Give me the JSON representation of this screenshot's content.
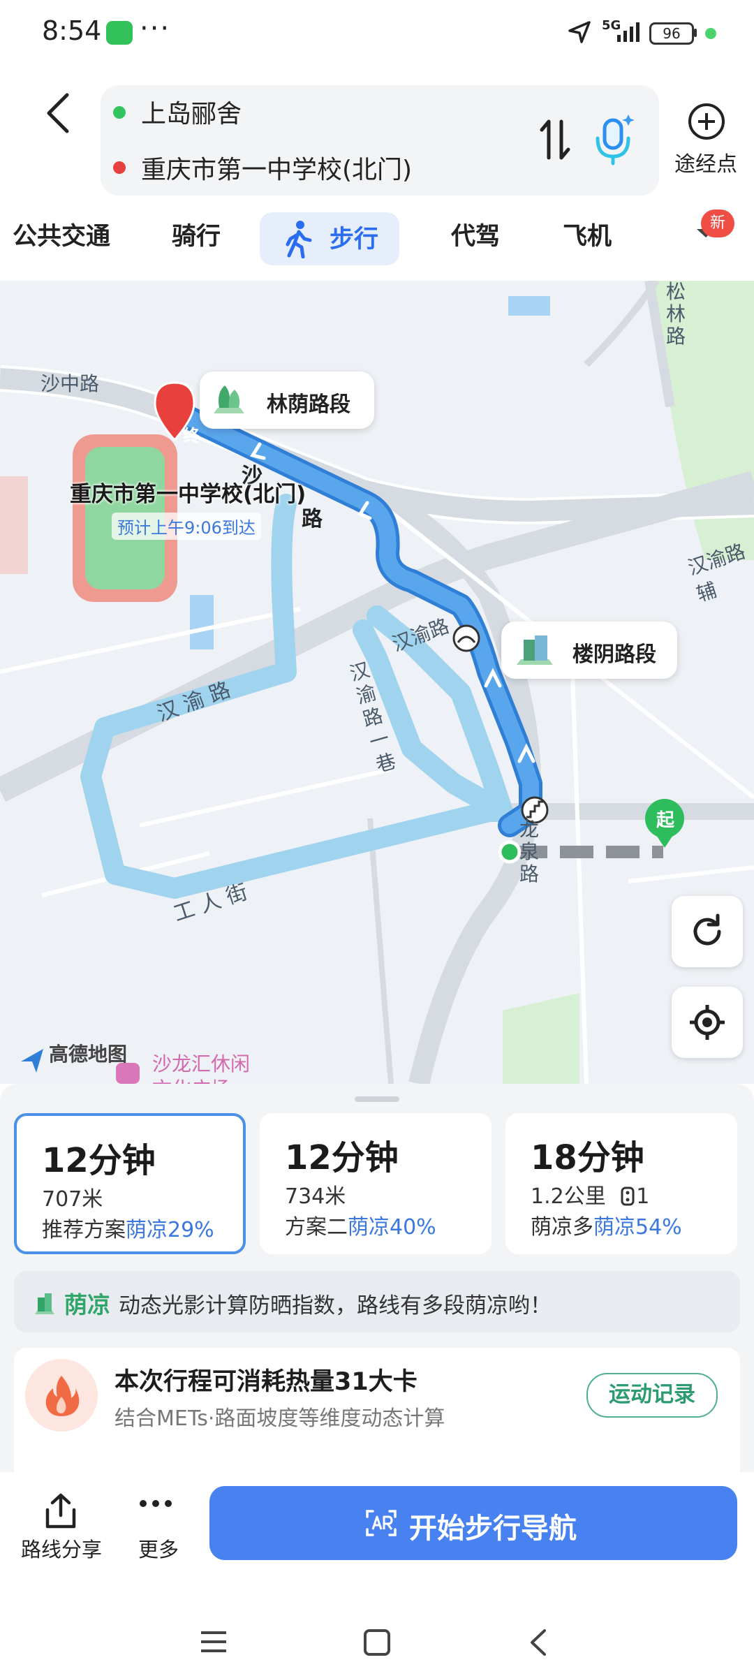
{
  "status_bar": {
    "time": "8:54",
    "dots": "···",
    "network": "5G",
    "battery": "96"
  },
  "header": {
    "origin": "上岛郦舍",
    "destination": "重庆市第一中学校(北门)",
    "waypoint_label": "途经点"
  },
  "modes": {
    "transit": "公共交通",
    "bike": "骑行",
    "walk": "步行",
    "driver": "代驾",
    "plane": "飞机",
    "new_badge": "新"
  },
  "map": {
    "road_shazhong": "沙中路",
    "road_sha_vertical_1": "沙",
    "road_sha_vertical_2": "路",
    "road_hanyu_1": "汉渝路",
    "road_hanyu_2": "汉 渝 路",
    "road_hanyu_alley": "汉渝路一巷",
    "road_hanyu_right": "汉渝路辅",
    "road_longquan": "龙泉路",
    "road_gongren": "工 人 街",
    "road_songlin": "松林路",
    "segment_shade_1": "林荫路段",
    "segment_shade_2": "楼阴路段",
    "dest_marker": "终",
    "origin_marker": "起",
    "dest_label": "重庆市第一中学校(北门)",
    "eta": "预计上午9:06到达",
    "brand": "高德地图",
    "poi": "沙龙汇休闲",
    "poi_line2": "文化广场"
  },
  "routes": [
    {
      "time": "12分钟",
      "distance": "707米",
      "tag": "推荐方案",
      "shade": "荫凉29%"
    },
    {
      "time": "12分钟",
      "distance": "734米",
      "tag": "方案二",
      "shade": "荫凉40%"
    },
    {
      "time": "18分钟",
      "distance": "1.2公里",
      "extra": "1",
      "tag": "荫凉多",
      "shade": "荫凉54%"
    }
  ],
  "shade_banner": {
    "title": "荫凉",
    "desc": "动态光影计算防晒指数，路线有多段荫凉哟！"
  },
  "calorie": {
    "title": "本次行程可消耗热量31大卡",
    "subtitle": "结合METs·路面坡度等维度动态计算",
    "button": "运动记录"
  },
  "actions": {
    "share": "路线分享",
    "more": "更多",
    "start": "开始步行导航"
  },
  "colors": {
    "accent": "#4882f0",
    "route_main": "#5aa6ec",
    "route_alt": "#9fd3ee",
    "shade_green": "#2fa56a"
  }
}
